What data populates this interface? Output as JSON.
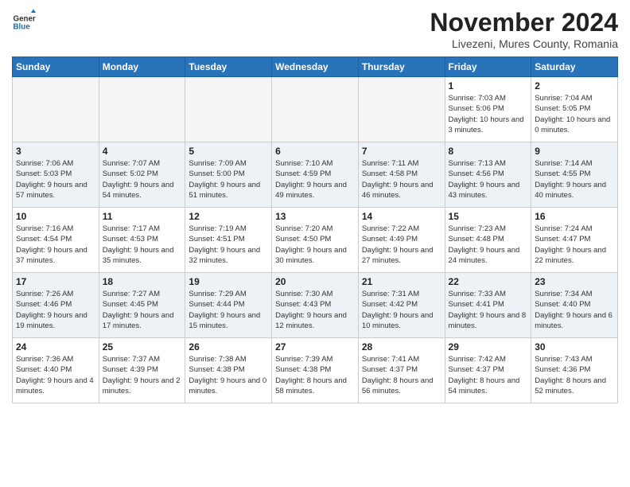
{
  "header": {
    "logo_general": "General",
    "logo_blue": "Blue",
    "month_title": "November 2024",
    "location": "Livezeni, Mures County, Romania"
  },
  "weekdays": [
    "Sunday",
    "Monday",
    "Tuesday",
    "Wednesday",
    "Thursday",
    "Friday",
    "Saturday"
  ],
  "weeks": [
    [
      {
        "day": "",
        "info": ""
      },
      {
        "day": "",
        "info": ""
      },
      {
        "day": "",
        "info": ""
      },
      {
        "day": "",
        "info": ""
      },
      {
        "day": "",
        "info": ""
      },
      {
        "day": "1",
        "info": "Sunrise: 7:03 AM\nSunset: 5:06 PM\nDaylight: 10 hours and 3 minutes."
      },
      {
        "day": "2",
        "info": "Sunrise: 7:04 AM\nSunset: 5:05 PM\nDaylight: 10 hours and 0 minutes."
      }
    ],
    [
      {
        "day": "3",
        "info": "Sunrise: 7:06 AM\nSunset: 5:03 PM\nDaylight: 9 hours and 57 minutes."
      },
      {
        "day": "4",
        "info": "Sunrise: 7:07 AM\nSunset: 5:02 PM\nDaylight: 9 hours and 54 minutes."
      },
      {
        "day": "5",
        "info": "Sunrise: 7:09 AM\nSunset: 5:00 PM\nDaylight: 9 hours and 51 minutes."
      },
      {
        "day": "6",
        "info": "Sunrise: 7:10 AM\nSunset: 4:59 PM\nDaylight: 9 hours and 49 minutes."
      },
      {
        "day": "7",
        "info": "Sunrise: 7:11 AM\nSunset: 4:58 PM\nDaylight: 9 hours and 46 minutes."
      },
      {
        "day": "8",
        "info": "Sunrise: 7:13 AM\nSunset: 4:56 PM\nDaylight: 9 hours and 43 minutes."
      },
      {
        "day": "9",
        "info": "Sunrise: 7:14 AM\nSunset: 4:55 PM\nDaylight: 9 hours and 40 minutes."
      }
    ],
    [
      {
        "day": "10",
        "info": "Sunrise: 7:16 AM\nSunset: 4:54 PM\nDaylight: 9 hours and 37 minutes."
      },
      {
        "day": "11",
        "info": "Sunrise: 7:17 AM\nSunset: 4:53 PM\nDaylight: 9 hours and 35 minutes."
      },
      {
        "day": "12",
        "info": "Sunrise: 7:19 AM\nSunset: 4:51 PM\nDaylight: 9 hours and 32 minutes."
      },
      {
        "day": "13",
        "info": "Sunrise: 7:20 AM\nSunset: 4:50 PM\nDaylight: 9 hours and 30 minutes."
      },
      {
        "day": "14",
        "info": "Sunrise: 7:22 AM\nSunset: 4:49 PM\nDaylight: 9 hours and 27 minutes."
      },
      {
        "day": "15",
        "info": "Sunrise: 7:23 AM\nSunset: 4:48 PM\nDaylight: 9 hours and 24 minutes."
      },
      {
        "day": "16",
        "info": "Sunrise: 7:24 AM\nSunset: 4:47 PM\nDaylight: 9 hours and 22 minutes."
      }
    ],
    [
      {
        "day": "17",
        "info": "Sunrise: 7:26 AM\nSunset: 4:46 PM\nDaylight: 9 hours and 19 minutes."
      },
      {
        "day": "18",
        "info": "Sunrise: 7:27 AM\nSunset: 4:45 PM\nDaylight: 9 hours and 17 minutes."
      },
      {
        "day": "19",
        "info": "Sunrise: 7:29 AM\nSunset: 4:44 PM\nDaylight: 9 hours and 15 minutes."
      },
      {
        "day": "20",
        "info": "Sunrise: 7:30 AM\nSunset: 4:43 PM\nDaylight: 9 hours and 12 minutes."
      },
      {
        "day": "21",
        "info": "Sunrise: 7:31 AM\nSunset: 4:42 PM\nDaylight: 9 hours and 10 minutes."
      },
      {
        "day": "22",
        "info": "Sunrise: 7:33 AM\nSunset: 4:41 PM\nDaylight: 9 hours and 8 minutes."
      },
      {
        "day": "23",
        "info": "Sunrise: 7:34 AM\nSunset: 4:40 PM\nDaylight: 9 hours and 6 minutes."
      }
    ],
    [
      {
        "day": "24",
        "info": "Sunrise: 7:36 AM\nSunset: 4:40 PM\nDaylight: 9 hours and 4 minutes."
      },
      {
        "day": "25",
        "info": "Sunrise: 7:37 AM\nSunset: 4:39 PM\nDaylight: 9 hours and 2 minutes."
      },
      {
        "day": "26",
        "info": "Sunrise: 7:38 AM\nSunset: 4:38 PM\nDaylight: 9 hours and 0 minutes."
      },
      {
        "day": "27",
        "info": "Sunrise: 7:39 AM\nSunset: 4:38 PM\nDaylight: 8 hours and 58 minutes."
      },
      {
        "day": "28",
        "info": "Sunrise: 7:41 AM\nSunset: 4:37 PM\nDaylight: 8 hours and 56 minutes."
      },
      {
        "day": "29",
        "info": "Sunrise: 7:42 AM\nSunset: 4:37 PM\nDaylight: 8 hours and 54 minutes."
      },
      {
        "day": "30",
        "info": "Sunrise: 7:43 AM\nSunset: 4:36 PM\nDaylight: 8 hours and 52 minutes."
      }
    ]
  ]
}
